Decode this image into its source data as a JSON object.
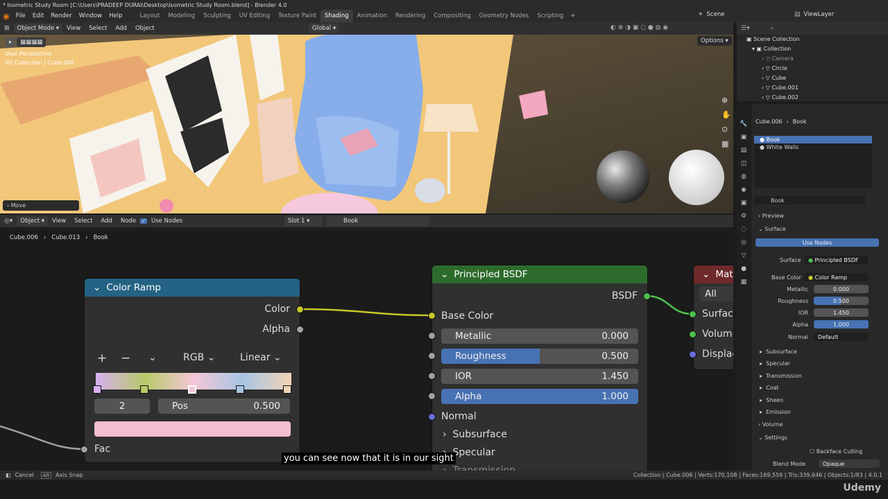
{
  "title": "* Isometric Study Room [C:\\Users\\PRADEEP DURAI\\Desktop\\Isometric Study Room.blend] - Blender 4.0",
  "menus": [
    "File",
    "Edit",
    "Render",
    "Window",
    "Help"
  ],
  "workspaces": [
    "Layout",
    "Modeling",
    "Sculpting",
    "UV Editing",
    "Texture Paint",
    "Shading",
    "Animation",
    "Rendering",
    "Compositing",
    "Geometry Nodes",
    "Scripting"
  ],
  "active_workspace": "Shading",
  "scene": "Scene",
  "view_layer": "ViewLayer",
  "viewport": {
    "mode": "Object Mode",
    "menus": [
      "View",
      "Select",
      "Add",
      "Object"
    ],
    "orientation": "Global",
    "options": "Options",
    "perspective": "User Perspective",
    "collection_info": "(0) Collection | Cube.006",
    "last_op": "Move"
  },
  "node_editor": {
    "type": "Object",
    "menus": [
      "View",
      "Select",
      "Add",
      "Node"
    ],
    "use_nodes": "Use Nodes",
    "slot": "Slot 1",
    "material": "Book",
    "breadcrumb": [
      "Cube.006",
      "Cube.013",
      "Book"
    ]
  },
  "color_ramp": {
    "title": "Color Ramp",
    "out_color": "Color",
    "out_alpha": "Alpha",
    "plus": "+",
    "minus": "−",
    "mode": "RGB",
    "interp": "Linear",
    "index": "2",
    "pos_label": "Pos",
    "pos_value": "0.500",
    "fac": "Fac",
    "stop_colors": [
      "#d8b0f0",
      "#b7c96a",
      "#f3c6d6",
      "#a9c5e4",
      "#f0d3b5"
    ],
    "swatch": "#f4bfd3"
  },
  "bsdf": {
    "title": "Principled BSDF",
    "output": "BSDF",
    "base_color": "Base Color",
    "metallic": [
      "Metallic",
      "0.000"
    ],
    "roughness": [
      "Roughness",
      "0.500"
    ],
    "ior": [
      "IOR",
      "1.450"
    ],
    "alpha": [
      "Alpha",
      "1.000"
    ],
    "normal": "Normal",
    "subsurface": "Subsurface",
    "specular": "Specular",
    "transmission": "Transmission",
    "roughness_fill": 0.5
  },
  "mat_output": {
    "title": "Mat",
    "target": "All",
    "surface": "Surfac",
    "volume": "Volum",
    "displacement": "Displac"
  },
  "outliner": {
    "title": "Scene Collection",
    "items": [
      {
        "name": "Collection"
      },
      {
        "name": "Camera"
      },
      {
        "name": "Circle"
      },
      {
        "name": "Cube"
      },
      {
        "name": "Cube.001"
      },
      {
        "name": "Cube.002"
      }
    ]
  },
  "properties": {
    "breadcrumb_obj": "Cube.006",
    "breadcrumb_mat": "Book",
    "slots": [
      "Book",
      "White Walls"
    ],
    "material_name": "Book",
    "preview": "Preview",
    "surface": "Surface",
    "use_nodes": "Use Nodes",
    "surface_label": "Surface",
    "surface_val": "Principled BSDF",
    "base_color_label": "Base Color",
    "base_color_val": "Color Ramp",
    "rows": [
      {
        "label": "Metallic",
        "value": "0.000"
      },
      {
        "label": "Roughness",
        "value": "0.500"
      },
      {
        "label": "IOR",
        "value": "1.450"
      },
      {
        "label": "Alpha",
        "value": "1.000"
      },
      {
        "label": "Normal",
        "value": "Default"
      }
    ],
    "sections": [
      "Subsurface",
      "Specular",
      "Transmission",
      "Coat",
      "Sheen",
      "Emission"
    ],
    "volume": "Volume",
    "settings": "Settings",
    "backface": "Backface Culling",
    "blend_label": "Blend Mode",
    "blend_val": "Opaque"
  },
  "subtitle": "you can see now that it is in our sight",
  "status": {
    "cancel": "Cancel",
    "alt": "Alt",
    "axis_snap": "Axis Snap",
    "stats": "Collection | Cube.006 | Verts:170,108 | Faces:169,559 | Tris:339,646 | Objects:1/83 | 4.0.1"
  },
  "watermark": "Udemy"
}
